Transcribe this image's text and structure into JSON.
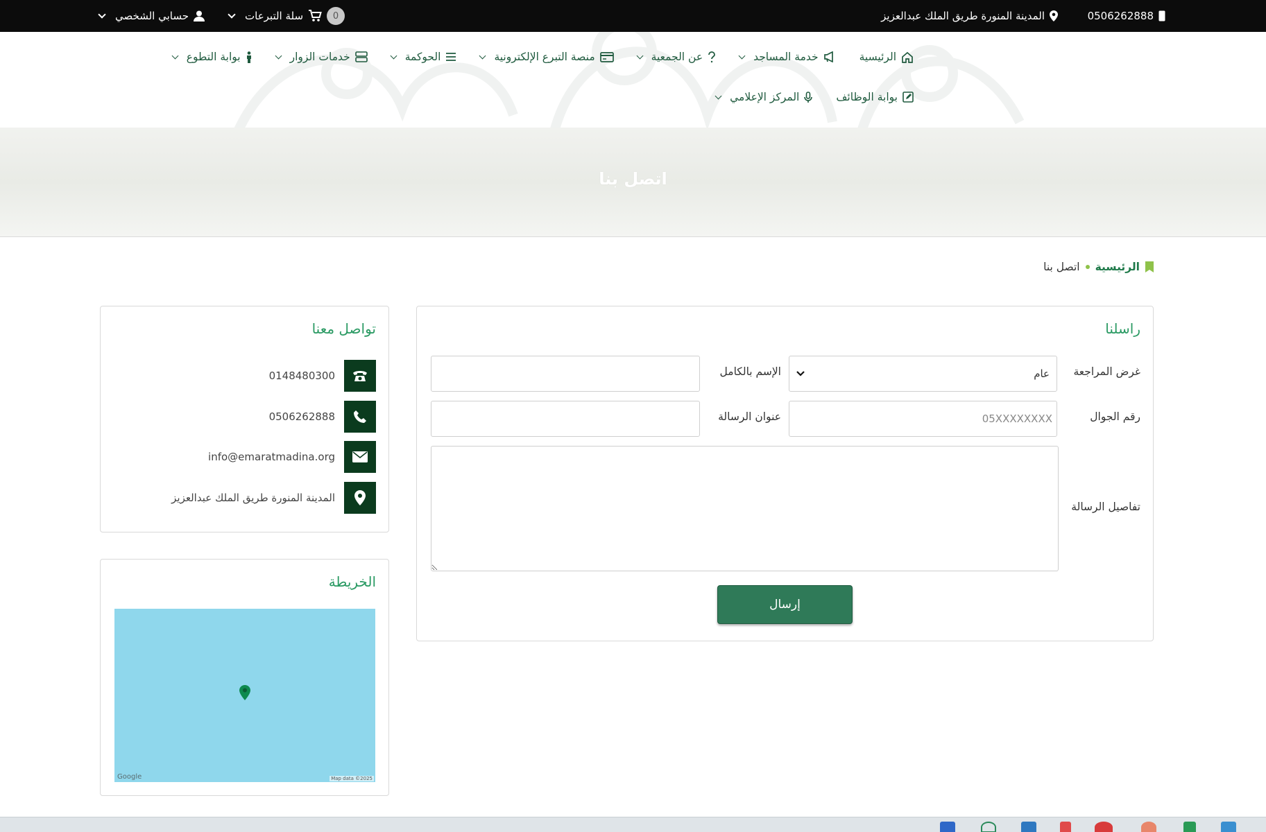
{
  "topbar": {
    "phone": "0506262888",
    "address": "المدينة المنورة طريق الملك عبدالعزيز",
    "cart_count": "0",
    "cart_label": "سلة التبرعات",
    "account_label": "حسابي الشخصي"
  },
  "nav": {
    "items": [
      {
        "label": "الرئيسية",
        "icon": "home-icon"
      },
      {
        "label": "خدمة المساجد",
        "icon": "megaphone-icon"
      },
      {
        "label": "عن الجمعية",
        "icon": "question-icon"
      },
      {
        "label": "منصة التبرع الإلكترونية",
        "icon": "card-icon"
      },
      {
        "label": "الحوكمة",
        "icon": "list-icon"
      },
      {
        "label": "خدمات الزوار",
        "icon": "server-icon"
      },
      {
        "label": "بوابة التطوع",
        "icon": "person-icon"
      },
      {
        "label": "بوابة الوظائف",
        "icon": "edit-icon"
      },
      {
        "label": "المركز الإعلامي",
        "icon": "microphone-icon"
      }
    ]
  },
  "banner": {
    "title": "اتصل بنا"
  },
  "breadcrumb": {
    "home": "الرئيسية",
    "current": "اتصل بنا"
  },
  "form": {
    "title": "راسلنا",
    "purpose_label": "غرض المراجعة",
    "purpose_value": "عام",
    "fullname_label": "الإسم بالكامل",
    "fullname_value": "",
    "mobile_label": "رقم الجوال",
    "mobile_placeholder": "05XXXXXXXX",
    "subject_label": "عنوان الرسالة",
    "subject_value": "",
    "details_label": "تفاصيل الرسالة",
    "details_value": "",
    "submit_label": "إرسال"
  },
  "contact": {
    "title": "تواصل معنا",
    "landline": "0148480300",
    "mobile": "0506262888",
    "email": "info@emaratmadina.org",
    "address": "المدينة المنورة طريق الملك عبدالعزيز"
  },
  "map": {
    "title": "الخريطة",
    "google_label": "Google",
    "data_label": "Map data ©2025"
  },
  "colors": {
    "topbar_bg": "#0c0c0c",
    "accent_green": "#2a9a63",
    "dark_green": "#0b3b1e",
    "button_green": "#2f7a58",
    "map_water": "#8fd7ec"
  }
}
